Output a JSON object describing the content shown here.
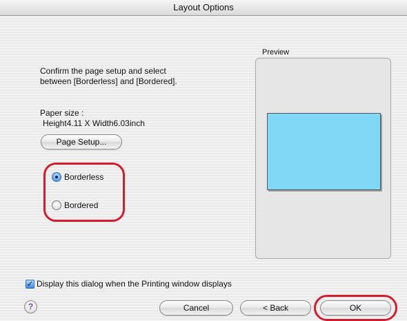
{
  "window": {
    "title": "Layout Options"
  },
  "instructions": {
    "line1": "Confirm the page setup and select",
    "line2": "between [Borderless] and [Bordered]."
  },
  "paper": {
    "label": "Paper size :",
    "value": "Height4.11 X Width6.03inch"
  },
  "page_setup_button": "Page Setup...",
  "layout_options": [
    {
      "label": "Borderless",
      "selected": true
    },
    {
      "label": "Bordered",
      "selected": false
    }
  ],
  "preview": {
    "label": "Preview",
    "page_color": "#7fd8f5"
  },
  "display_dialog_checkbox": {
    "label": "Display this dialog when the Printing window displays",
    "checked": true
  },
  "help_button": {
    "label": "?",
    "icon": "help-icon"
  },
  "buttons": {
    "cancel": "Cancel",
    "back": "< Back",
    "ok": "OK"
  },
  "colors": {
    "highlight": "#d61a2e",
    "selection_blue": "#3b86e0"
  }
}
